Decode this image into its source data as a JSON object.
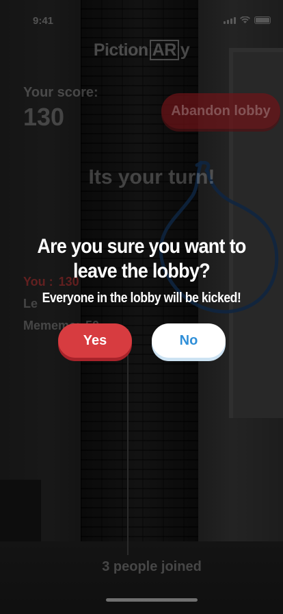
{
  "status_bar": {
    "time": "9:41"
  },
  "header": {
    "logo_prefix": "Piction",
    "logo_ar": "AR",
    "logo_suffix": "y"
  },
  "score": {
    "label": "Your score:",
    "value": "130"
  },
  "abandon_button": {
    "label": "Abandon lobby"
  },
  "turn_text": "Its your turn!",
  "players": [
    {
      "name": "You :",
      "score": "130"
    },
    {
      "name": "Le",
      "score": ""
    },
    {
      "name": "Mememe:",
      "score": "50"
    }
  ],
  "footer": {
    "joined": "3 people joined"
  },
  "modal": {
    "title_line1": "Are you sure you want to",
    "title_line2": "leave the lobby?",
    "subtitle": "Everyone in the lobby will be kicked!",
    "yes_label": "Yes",
    "no_label": "No"
  },
  "colors": {
    "yes_button": "#d73c40",
    "no_button_text": "#2f8fd8",
    "drawing_stroke": "#1f4f8a"
  }
}
